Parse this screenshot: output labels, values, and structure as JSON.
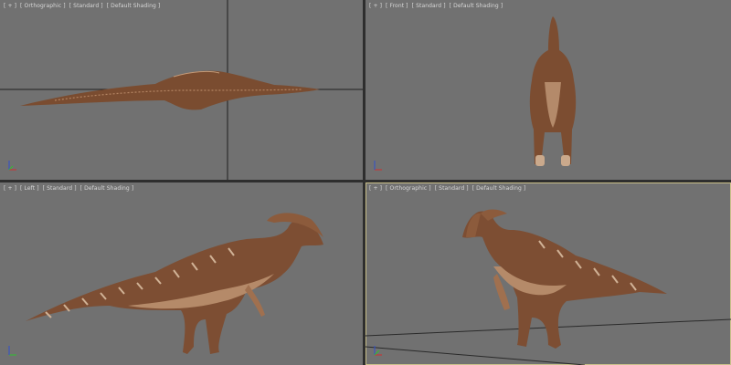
{
  "viewports": [
    {
      "id": "top",
      "labels": [
        "[ + ]",
        "[ Orthographic ]",
        "[ Standard ]",
        "[ Default Shading ]"
      ],
      "active": false
    },
    {
      "id": "front",
      "labels": [
        "[ + ]",
        "[ Front ]",
        "[ Standard ]",
        "[ Default Shading ]"
      ],
      "active": false
    },
    {
      "id": "left",
      "labels": [
        "[ + ]",
        "[ Left ]",
        "[ Standard ]",
        "[ Default Shading ]"
      ],
      "active": false
    },
    {
      "id": "perspective",
      "labels": [
        "[ + ]",
        "[ Orthographic ]",
        "[ Standard ]",
        "[ Default Shading ]"
      ],
      "active": true
    }
  ],
  "colors": {
    "viewport_bg": "#717171",
    "grid_line": "#1e1e1e",
    "active_border": "#c9c08a",
    "model_dark": "#6a4129",
    "model_mid": "#8a5a3c",
    "model_light": "#b78a6a",
    "axis_x": "#d03030",
    "axis_y": "#30c030",
    "axis_z": "#3050d0"
  },
  "icons": [
    "axis-gizmo-icon"
  ]
}
